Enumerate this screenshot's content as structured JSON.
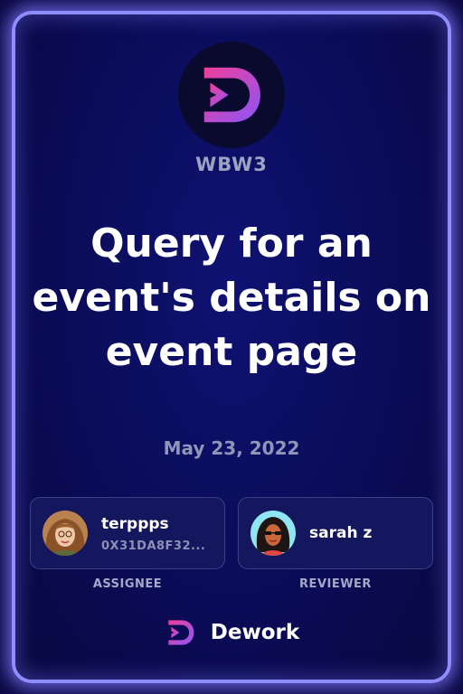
{
  "organization": {
    "name": "WBW3"
  },
  "task": {
    "title": "Query for an event's details on event page",
    "date": "May 23, 2022"
  },
  "assignee": {
    "name": "terppps",
    "address": "0X31DA8F32...",
    "role_label": "ASSIGNEE"
  },
  "reviewer": {
    "name": "sarah z",
    "role_label": "REVIEWER"
  },
  "footer": {
    "brand": "Dework"
  },
  "icons": {
    "org_logo": "dework-d-logo-icon",
    "footer_logo": "dework-d-logo-icon"
  },
  "colors": {
    "background": "#0b0a44",
    "card_border": "#8f8cff",
    "title": "#ffffff",
    "muted_text": "#9ea3c4",
    "brand_gradient_start": "#e93ea0",
    "brand_gradient_end": "#8e52f5"
  }
}
